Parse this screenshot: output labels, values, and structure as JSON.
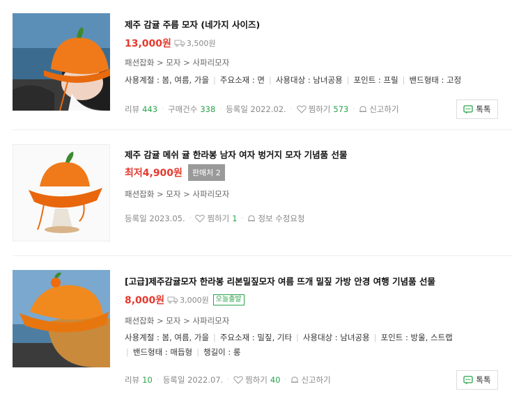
{
  "products": [
    {
      "title": "제주 감귤 주름 모자 (네가지 사이즈)",
      "price": "13,000원",
      "shipping": "3,500원",
      "category": [
        "패션잡화",
        "모자",
        "사파리모자"
      ],
      "attrs_line1": [
        "사용계절 : 봄, 여름, 가을",
        "주요소재 : 면",
        "사용대상 : 남녀공용",
        "포인트 : 프릴",
        "밴드형태 : 고정"
      ],
      "meta": {
        "review_label": "리뷰",
        "review_count": "443",
        "purchase_label": "구매건수",
        "purchase_count": "338",
        "date": "등록일 2022.02.",
        "wish_label": "찜하기",
        "wish_count": "573",
        "report_label": "신고하기"
      },
      "talk_label": "톡톡"
    },
    {
      "title": "제주 감귤 메쉬 귤 한라봉 남자 여자 벙거지 모자 기념품 선물",
      "price": "최저4,900원",
      "seller_badge": "판매처 2",
      "category": [
        "패션잡화",
        "모자",
        "사파리모자"
      ],
      "meta": {
        "date": "등록일 2023.05.",
        "wish_label": "찜하기",
        "wish_count": "1",
        "report_label": "정보 수정요청"
      }
    },
    {
      "title": "[고급]제주감귤모자 한라봉 리본밀짚모자 여름 뜨개 밀짚 가방 안경 여행 기념품 선물",
      "price": "8,000원",
      "shipping": "3,000원",
      "today_badge": "오늘출발",
      "category": [
        "패션잡화",
        "모자",
        "사파리모자"
      ],
      "attrs_line1": [
        "사용계절 : 봄, 여름, 가을",
        "주요소재 : 밀짚, 기타",
        "사용대상 : 남녀공용",
        "포인트 : 방울, 스트랩"
      ],
      "attrs_line2": [
        "밴드형태 : 매듭형",
        "챙길이 : 롱"
      ],
      "meta": {
        "review_label": "리뷰",
        "review_count": "10",
        "date": "등록일 2022.07.",
        "wish_label": "찜하기",
        "wish_count": "40",
        "report_label": "신고하기"
      },
      "talk_label": "톡톡"
    }
  ],
  "colors": {
    "price": "#e43a2e",
    "count": "#2aa34a",
    "badge_gray": "#9a9a9a"
  },
  "icons": [
    "truck-icon",
    "heart-icon",
    "bell-icon",
    "chat-icon"
  ]
}
